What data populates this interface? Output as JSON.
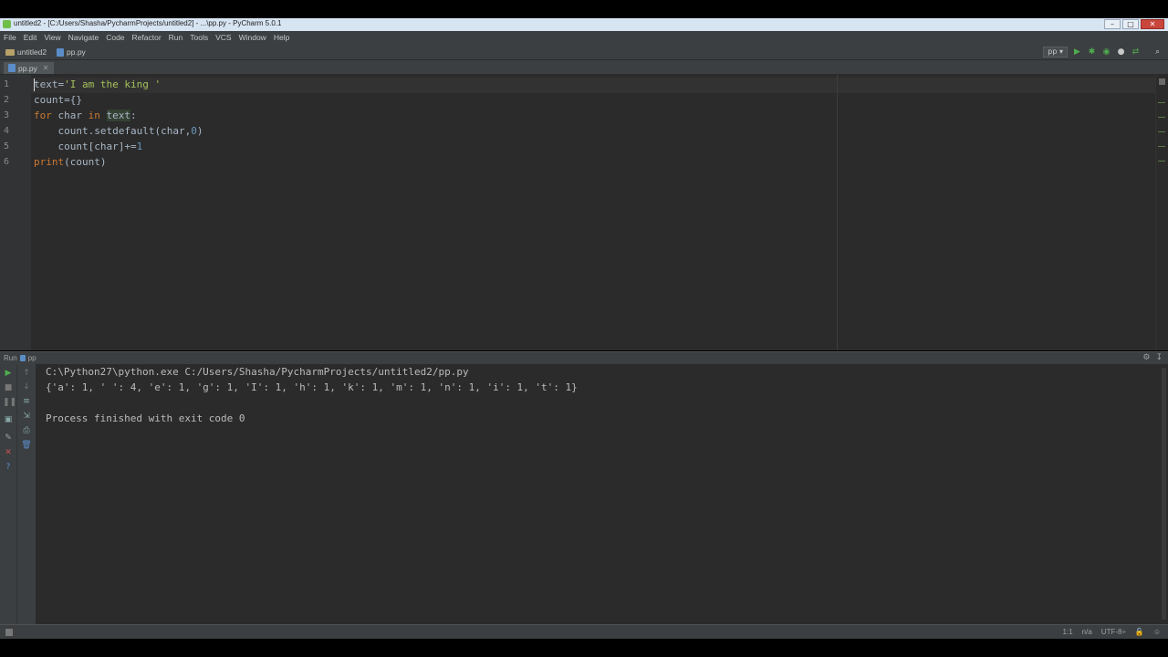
{
  "window": {
    "title": "untitled2 - [C:/Users/Shasha/PycharmProjects/untitled2] - ...\\pp.py - PyCharm 5.0.1"
  },
  "menu": {
    "items": [
      {
        "label": "File"
      },
      {
        "label": "Edit"
      },
      {
        "label": "View"
      },
      {
        "label": "Navigate"
      },
      {
        "label": "Code"
      },
      {
        "label": "Refactor"
      },
      {
        "label": "Run"
      },
      {
        "label": "Tools"
      },
      {
        "label": "VCS"
      },
      {
        "label": "Window"
      },
      {
        "label": "Help"
      }
    ]
  },
  "navbar": {
    "project": "untitled2",
    "file": "pp.py",
    "run_config": "pp"
  },
  "tabs": [
    {
      "label": "pp.py"
    }
  ],
  "editor": {
    "line_numbers": [
      "1",
      "2",
      "3",
      "4",
      "5",
      "6"
    ],
    "lines": [
      {
        "p0": "text=",
        "s0": "'I am the king '"
      },
      {
        "p0": "count={}"
      },
      {
        "k0": "for",
        "p0": " char ",
        "k1": "in",
        "p1": " ",
        "h0": "text",
        "p2": ":"
      },
      {
        "p0": "    count.setdefault(char,",
        "n0": "0",
        "p1": ")"
      },
      {
        "p0": "    count[char]+=",
        "n0": "1"
      },
      {
        "k0": "print",
        "p0": "(count)"
      }
    ]
  },
  "run_panel": {
    "title": "Run",
    "config": "pp",
    "console": [
      "C:\\Python27\\python.exe C:/Users/Shasha/PycharmProjects/untitled2/pp.py",
      "{'a': 1, ' ': 4, 'e': 1, 'g': 1, 'I': 1, 'h': 1, 'k': 1, 'm': 1, 'n': 1, 'i': 1, 't': 1}",
      "",
      "Process finished with exit code 0"
    ]
  },
  "statusbar": {
    "position": "1:1",
    "line_sep": "n/a",
    "encoding": "UTF-8÷"
  },
  "colors": {
    "keyword": "#cc7832",
    "string": "#a5c25c",
    "number": "#6897bb",
    "run_green": "#4fae4f",
    "stop_red": "#c75450"
  },
  "icons": {
    "run": "run-icon",
    "debug": "debug-icon",
    "stop": "stop-icon",
    "search": "search-icon",
    "settings": "gear-icon"
  }
}
